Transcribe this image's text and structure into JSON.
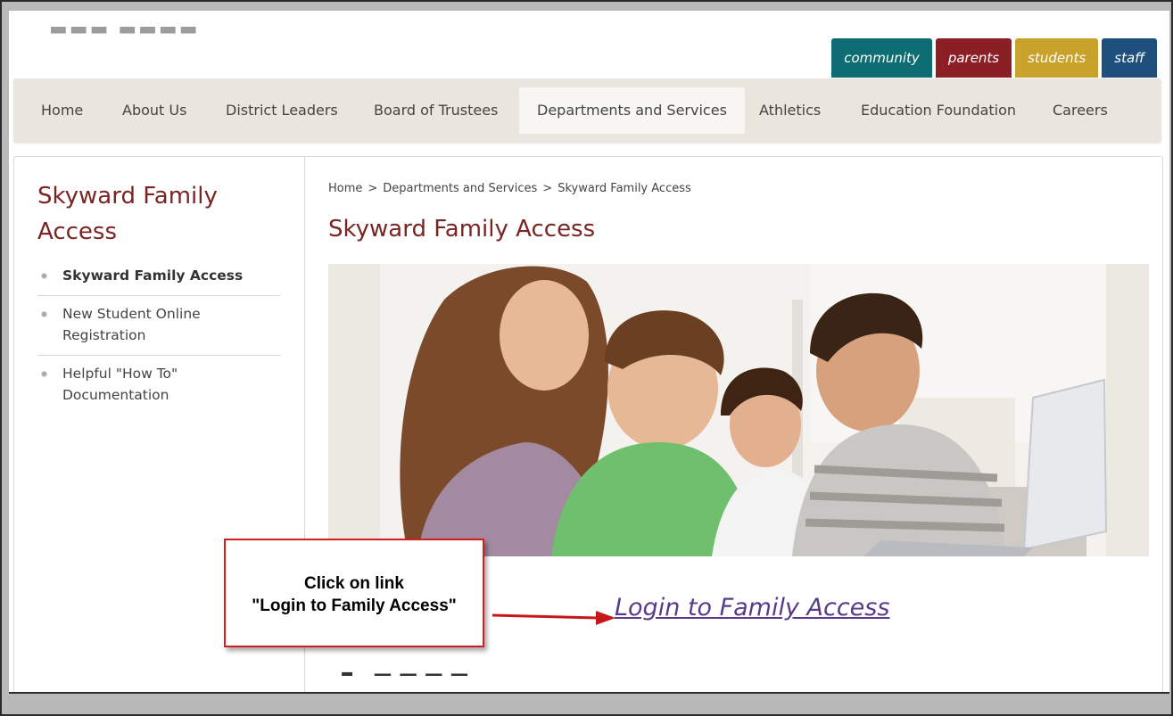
{
  "audience_tabs": [
    {
      "label": "community",
      "color": "#0e6d73"
    },
    {
      "label": "parents",
      "color": "#8c1f25"
    },
    {
      "label": "students",
      "color": "#c9a22c"
    },
    {
      "label": "staff",
      "color": "#1f4f7d"
    }
  ],
  "nav": {
    "items": [
      "Home",
      "About Us",
      "District Leaders",
      "Board of Trustees",
      "Departments and Services",
      "Athletics",
      "Education Foundation",
      "Careers"
    ],
    "active": "Departments and Services"
  },
  "sidebar": {
    "title": "Skyward Family Access",
    "items": [
      {
        "label": "Skyward Family Access",
        "current": true
      },
      {
        "label": "New Student Online Registration",
        "current": false
      },
      {
        "label": "Helpful \"How To\" Documentation",
        "current": false
      }
    ]
  },
  "breadcrumb": [
    "Home",
    "Departments and Services",
    "Skyward Family Access"
  ],
  "breadcrumb_separator": ">",
  "main": {
    "title": "Skyward Family Access",
    "login_link": "Login to Family Access"
  },
  "callout": {
    "line1": "Click on link",
    "line2": "\"Login to Family Access\""
  },
  "colors": {
    "accent": "#7b2424",
    "link": "#5a3b8a",
    "callout_border": "#d41f1f",
    "nav_bg": "#ebe6dd"
  }
}
